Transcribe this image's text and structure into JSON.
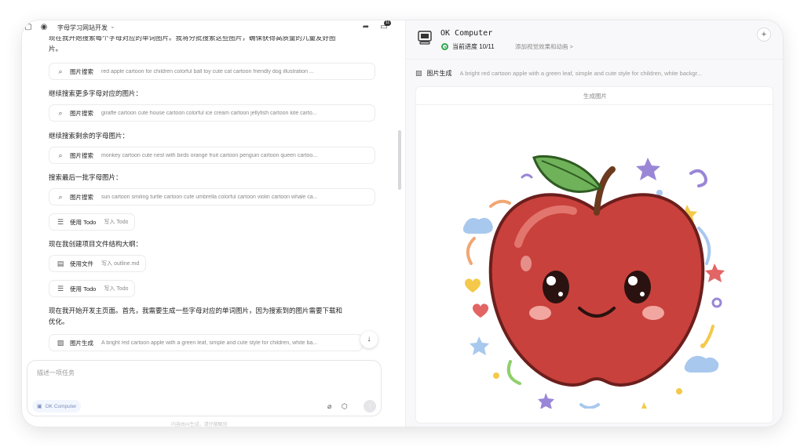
{
  "left": {
    "project_title": "字母学习网站开发",
    "badge": "11",
    "cut_text": "现在我开始搜索每个字母对应的单词图片。我将分批搜索这些图片，确保获得高质量的儿童友好图",
    "messages": [
      {
        "kind": "text",
        "text": "片。"
      },
      {
        "kind": "tool",
        "icon": "search-icon",
        "name": "图片搜索",
        "desc": "red apple cartoon for children colorful ball toy cute cat cartoon friendly dog illustration ..."
      },
      {
        "kind": "text",
        "text": "继续搜索更多字母对应的图片："
      },
      {
        "kind": "tool",
        "icon": "search-icon",
        "name": "图片搜索",
        "desc": "giraffe cartoon cute house cartoon colorful ice cream cartoon jellyfish cartoon kite carto..."
      },
      {
        "kind": "text",
        "text": "继续搜索剩余的字母图片："
      },
      {
        "kind": "tool",
        "icon": "search-icon",
        "name": "图片搜索",
        "desc": "monkey cartoon cute nest with birds orange fruit cartoon penguin cartoon queen cartoo..."
      },
      {
        "kind": "text",
        "text": "搜索最后一批字母图片："
      },
      {
        "kind": "tool",
        "icon": "search-icon",
        "name": "图片搜索",
        "desc": "sun cartoon smiling turtle cartoon cute umbrella colorful cartoon violin cartoon whale ca..."
      },
      {
        "kind": "tool",
        "icon": "todo-icon",
        "name": "使用 Todo",
        "desc": "写入 Todo"
      },
      {
        "kind": "text",
        "text": "现在我创建项目文件结构大纲："
      },
      {
        "kind": "tool",
        "icon": "file-icon",
        "name": "使用文件",
        "desc": "写入 outline.md"
      },
      {
        "kind": "tool",
        "icon": "todo-icon",
        "name": "使用 Todo",
        "desc": "写入 Todo"
      },
      {
        "kind": "text",
        "text": "现在我开始开发主页面。首先，我需要生成一些字母对应的单词图片，因为搜索到的图片需要下载和"
      },
      {
        "kind": "text",
        "text": "优化。"
      },
      {
        "kind": "tool",
        "icon": "image-icon",
        "name": "图片生成",
        "desc": "A bright red cartoon apple with a green leaf, simple and cute style for children, white ba..."
      }
    ],
    "composer": {
      "placeholder": "描述一项任务",
      "agent_label": "OK Computer"
    },
    "footer_note": "内容由AI生成，请仔细甄别"
  },
  "right": {
    "app_title": "OK Computer",
    "progress_text": "当前进度 10/11",
    "next_task": "添加视觉效果和动画 >",
    "tool": {
      "name": "图片生成",
      "desc": "A bright red cartoon apple with a green leaf, simple and cute style for children, white backgr..."
    },
    "gen_label": "生成图片"
  },
  "colors": {
    "apple_red": "#c9413c",
    "leaf_green": "#6fb25a",
    "progress_green": "#2ba84a"
  }
}
